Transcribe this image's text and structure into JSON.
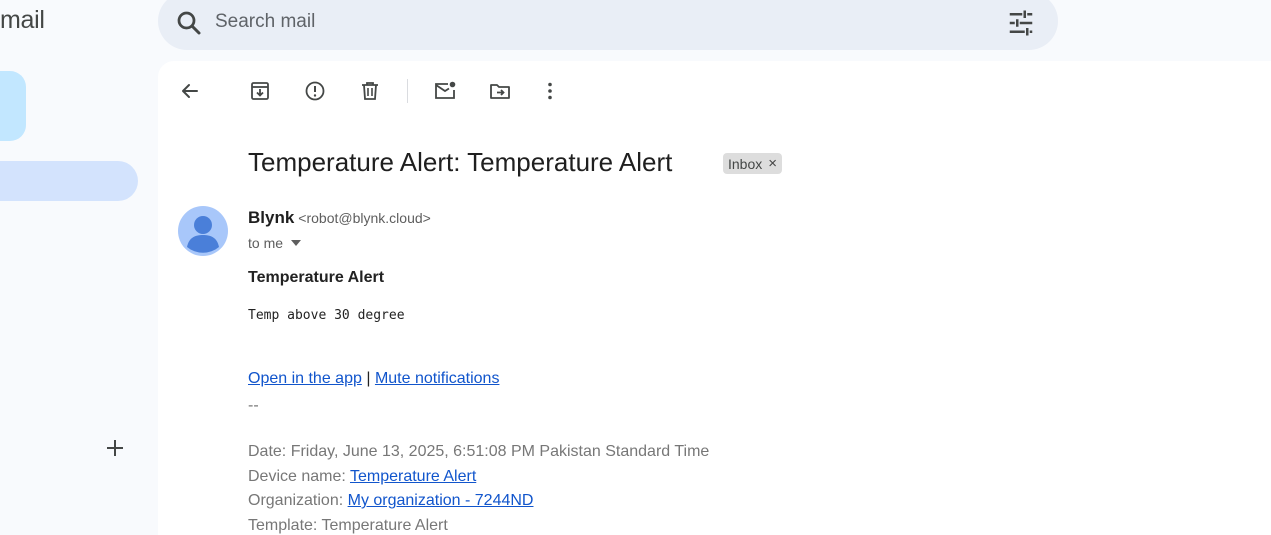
{
  "app": {
    "logo_text": "mail"
  },
  "search": {
    "placeholder": "Search mail",
    "value": ""
  },
  "toolbar": {
    "icons": [
      "back-arrow-icon",
      "archive-icon",
      "report-spam-icon",
      "delete-icon",
      "mark-unread-icon",
      "move-to-icon",
      "more-vert-icon"
    ]
  },
  "email": {
    "subject": "Temperature Alert: Temperature Alert",
    "label": "Inbox",
    "label_remove": "×",
    "sender_name": "Blynk",
    "sender_address": "<robot@blynk.cloud>",
    "recipient": "to me",
    "body_title": "Temperature Alert",
    "body_message": "Temp above 30 degree",
    "link_open_app": "Open in the app",
    "link_separator": "|",
    "link_mute": "Mute notifications",
    "divider": "--",
    "date_line": "Date: Friday, June 13, 2025, 6:51:08 PM Pakistan Standard Time",
    "device_label": "Device name: ",
    "device_value": "Temperature Alert",
    "org_label": "Organization: ",
    "org_value": "My organization - 7244ND",
    "template_line": "Template: Temperature Alert"
  },
  "sidebar": {
    "new_label_icon": "plus-icon"
  }
}
